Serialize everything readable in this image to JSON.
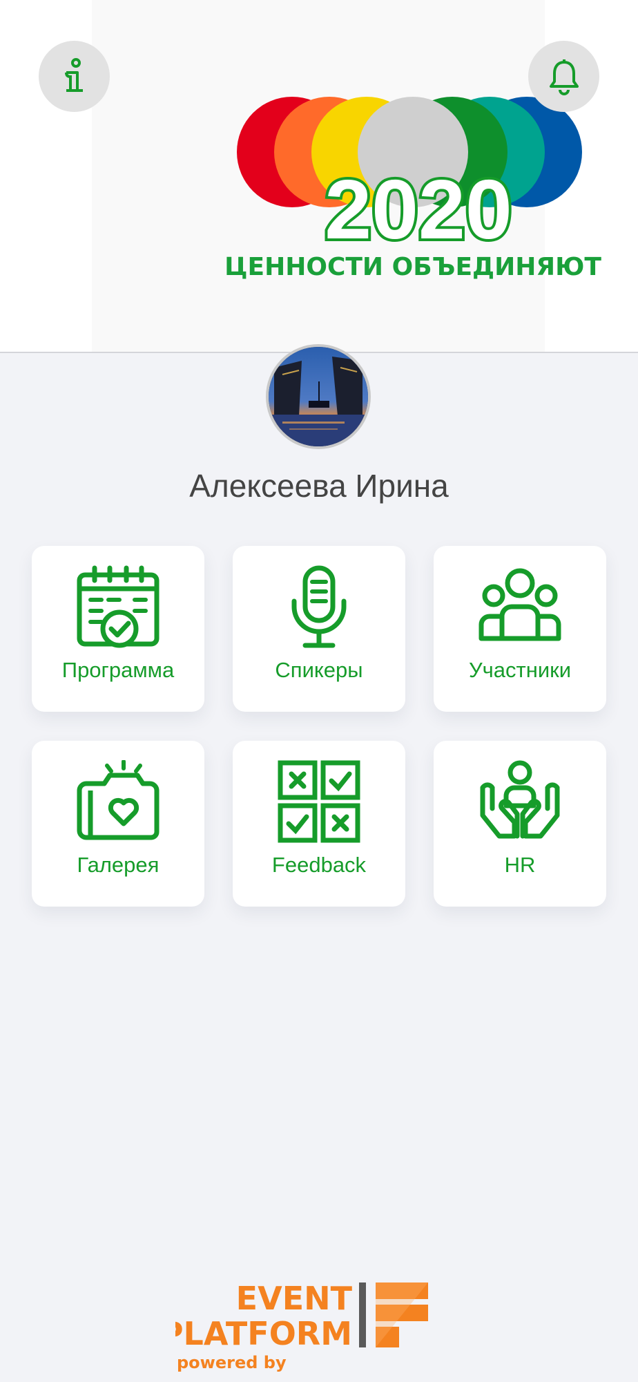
{
  "header": {
    "info_icon": "info-icon",
    "bell_icon": "bell-icon",
    "logo": {
      "year": "2020",
      "slogan": "ЦЕННОСТИ ОБЪЕДИНЯЮТ",
      "circle_colors": [
        "#e3001b",
        "#ff6a2a",
        "#f8d500",
        "#cfcfcf",
        "#0e8f2c",
        "#00a38f",
        "#0058a8"
      ]
    }
  },
  "user": {
    "name": "Алексеева Ирина",
    "avatar": "avatar-photo-bridge"
  },
  "menu": {
    "tiles": [
      {
        "label": "Программа",
        "icon": "calendar-check-icon"
      },
      {
        "label": "Спикеры",
        "icon": "microphone-icon"
      },
      {
        "label": "Участники",
        "icon": "people-group-icon"
      },
      {
        "label": "Галерея",
        "icon": "camera-heart-icon"
      },
      {
        "label": "Feedback",
        "icon": "checklist-grid-icon"
      },
      {
        "label": "HR",
        "icon": "hands-person-icon"
      }
    ]
  },
  "footer": {
    "brand_line1": "EVENT",
    "brand_line2": "PLATFORM",
    "powered_by": "powered by"
  },
  "colors": {
    "accent_green": "#169c2a",
    "brand_orange": "#f48220",
    "background": "#f2f3f7"
  }
}
